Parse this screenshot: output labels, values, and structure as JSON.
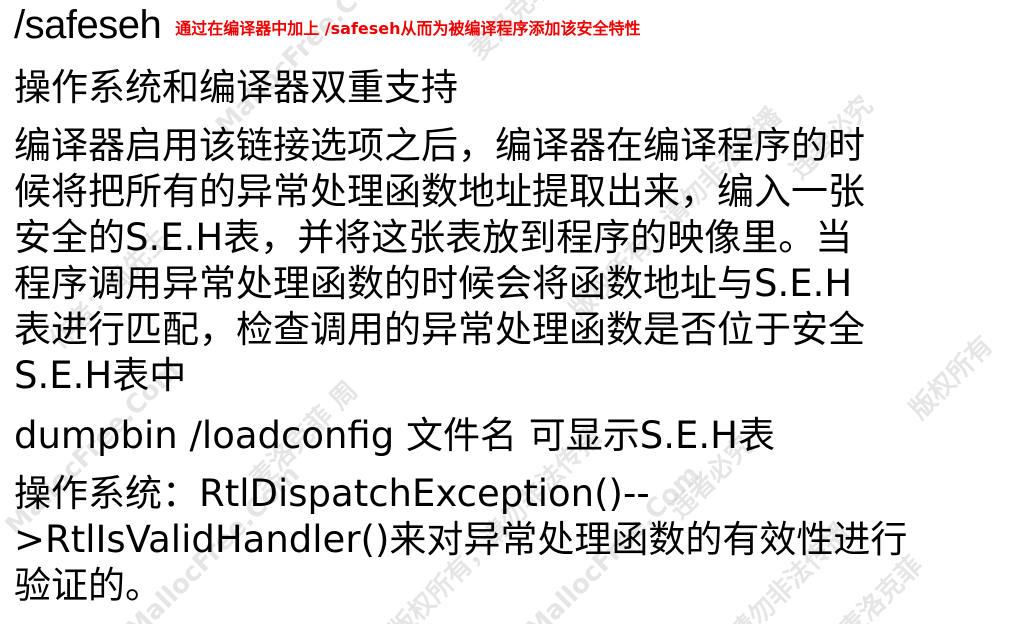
{
  "header": {
    "title": "/safeseh",
    "note": "通过在编译器中加上 /safeseh从而为被编译程序添加该安全特性",
    "note_color": "#ee0000"
  },
  "body": {
    "heading": "操作系统和编译器双重支持",
    "paragraph1_lines": [
      "编译器启用该链接选项之后，编译器在编译程序的时",
      "候将把所有的异常处理函数地址提取出来，编入一张",
      "安全的S.E.H表，并将这张表放到程序的映像里。当",
      "程序调用异常处理函数的时候会将函数地址与S.E.H",
      "表进行匹配，检查调用的异常处理函数是否位于安全",
      "S.E.H表中"
    ],
    "paragraph2": "dumpbin  /loadconfig 文件名 可显示S.E.H表",
    "paragraph3_lines": [
      "操作系统：RtlDispatchException()--",
      ">RtlIsValidHandler()来对异常处理函数的有效性进行",
      "验证的。"
    ]
  },
  "watermark": {
    "texts": [
      "MallocFree.Com",
      "麦洛克菲",
      "版权所有，请勿非法传播",
      "违者必究",
      "作者：周先生",
      "MallocFree.Com",
      "麦洛克菲 周",
      "版权所有，请勿非法传播",
      "违者必究",
      "MallocFree.Com",
      "麦洛克菲",
      "版权所有",
      "请勿非法传播",
      "MallocFree.Com"
    ]
  }
}
